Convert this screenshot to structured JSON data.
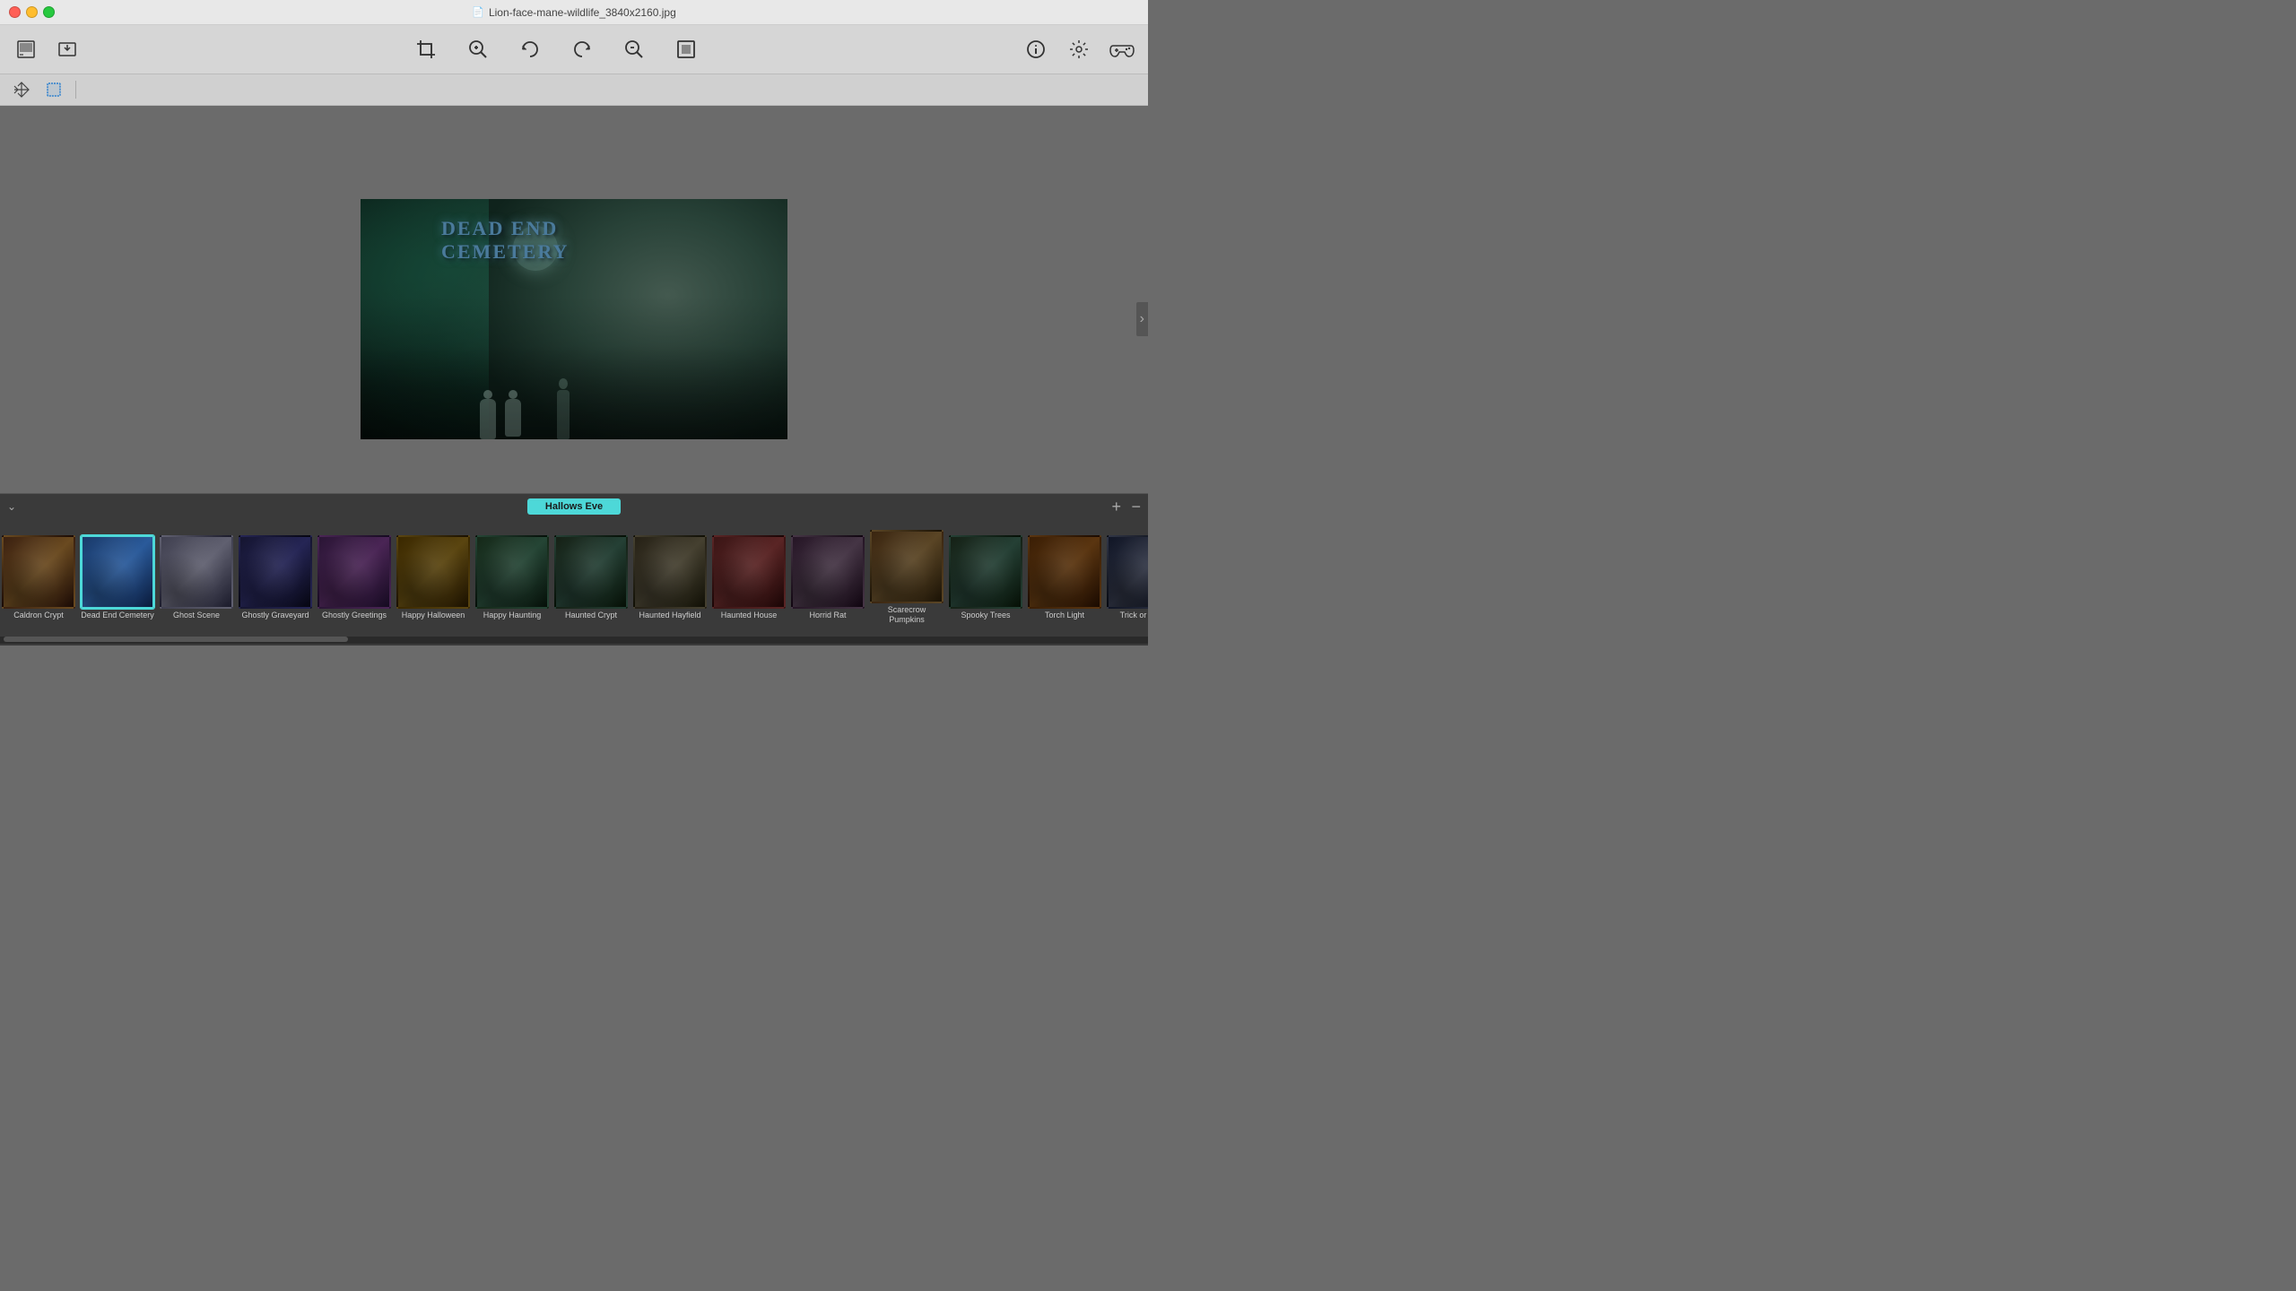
{
  "window": {
    "title": "Lion-face-mane-wildlife_3840x2160.jpg"
  },
  "toolbar": {
    "crop_label": "⊡",
    "zoom_in_label": "🔍",
    "rotate_left_label": "↩",
    "rotate_right_label": "↪",
    "zoom_out_label": "🔍",
    "fit_label": "⊞",
    "info_label": "ℹ",
    "settings_label": "⚙",
    "gamepad_label": "🎮"
  },
  "secondary_toolbar": {
    "move_label": "⤢",
    "crop_select_label": "⬚"
  },
  "main_image": {
    "cemetery_text_line1": "Dead End",
    "cemetery_text_line2": "Cemetery"
  },
  "hallows_bar": {
    "label": "Hallows Eve"
  },
  "thumbnails": [
    {
      "id": "caldron-crypt",
      "label": "Caldron Crypt",
      "selected": false,
      "color_class": "thumb-caldron"
    },
    {
      "id": "dead-end-cemetery",
      "label": "Dead End\nCemetery",
      "selected": true,
      "color_class": "thumb-deadend"
    },
    {
      "id": "ghost-scene",
      "label": "Ghost Scene",
      "selected": false,
      "color_class": "thumb-ghost"
    },
    {
      "id": "ghostly-graveyard",
      "label": "Ghostly\nGraveyard",
      "selected": false,
      "color_class": "thumb-ghostlygraveyard"
    },
    {
      "id": "ghostly-greetings",
      "label": "Ghostly\nGreetings",
      "selected": false,
      "color_class": "thumb-ghostlygreetings"
    },
    {
      "id": "happy-halloween",
      "label": "Happy Halloween",
      "selected": false,
      "color_class": "thumb-happyhalloween"
    },
    {
      "id": "happy-haunting",
      "label": "Happy Haunting",
      "selected": false,
      "color_class": "thumb-happyhaunting"
    },
    {
      "id": "haunted-crypt",
      "label": "Haunted Crypt",
      "selected": false,
      "color_class": "thumb-hauntedcrypt"
    },
    {
      "id": "haunted-hayfield",
      "label": "Haunted Hayfield",
      "selected": false,
      "color_class": "thumb-hauntedhayfield"
    },
    {
      "id": "haunted-house",
      "label": "Haunted House",
      "selected": false,
      "color_class": "thumb-hauntedhouse"
    },
    {
      "id": "horrid-rat",
      "label": "Horrid Rat",
      "selected": false,
      "color_class": "thumb-horridrat"
    },
    {
      "id": "scarecrow-pumpkins",
      "label": "Scarecrow\nPumpkins",
      "selected": false,
      "color_class": "thumb-scarecrow"
    },
    {
      "id": "spooky-trees",
      "label": "Spooky Trees",
      "selected": false,
      "color_class": "thumb-spookytrees"
    },
    {
      "id": "torch-light",
      "label": "Torch Light",
      "selected": false,
      "color_class": "thumb-torchlight"
    },
    {
      "id": "extra-1",
      "label": "Trick or Treat",
      "selected": false,
      "color_class": "thumb-extra1"
    },
    {
      "id": "extra-2",
      "label": "",
      "selected": false,
      "color_class": "thumb-extra2"
    }
  ]
}
